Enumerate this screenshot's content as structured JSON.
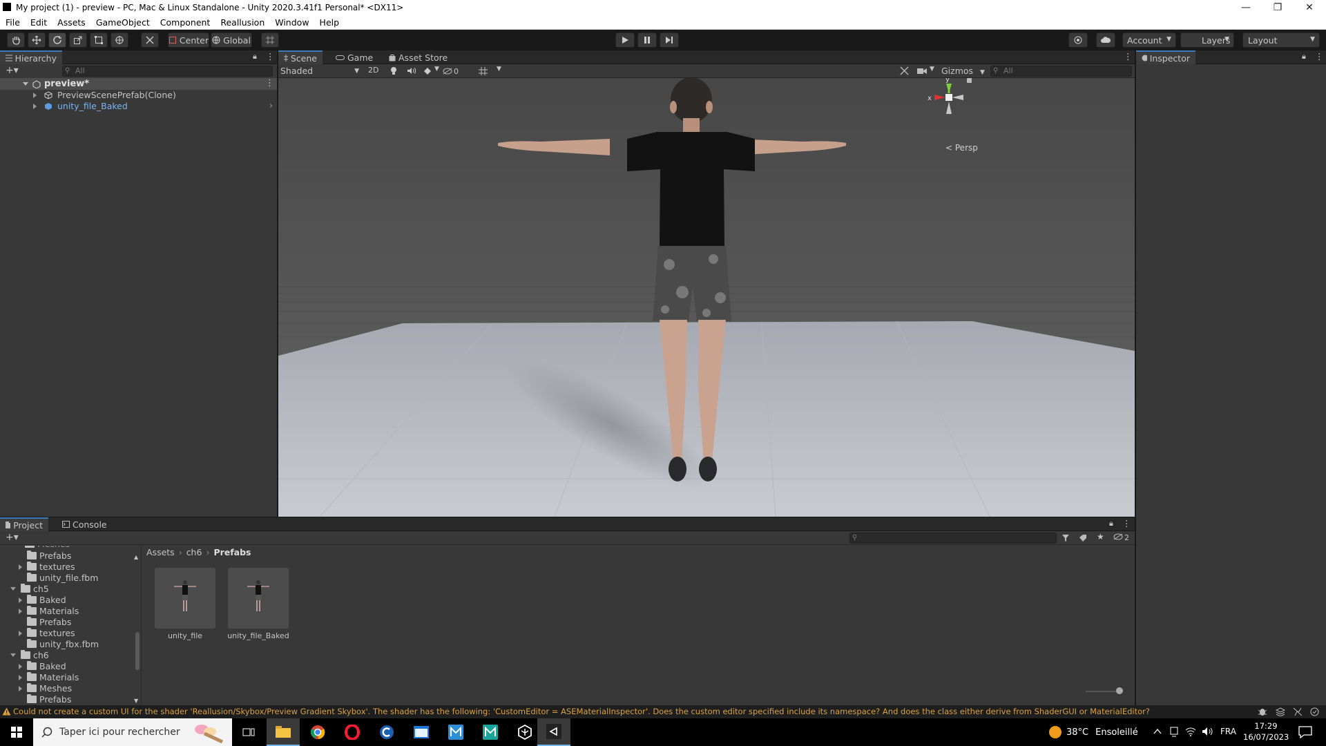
{
  "window": {
    "title": "My project (1) - preview - PC, Mac & Linux Standalone - Unity 2020.3.41f1 Personal* <DX11>",
    "minimize": "—",
    "maximize": "❐",
    "close": "✕"
  },
  "menu": [
    "File",
    "Edit",
    "Assets",
    "GameObject",
    "Component",
    "Reallusion",
    "Window",
    "Help"
  ],
  "toolbar": {
    "pivot": "Center",
    "space": "Global",
    "account": "Account",
    "layers": "Layers",
    "layout": "Layout"
  },
  "hierarchy": {
    "tab": "Hierarchy",
    "search_placeholder": "All",
    "scene": "preview*",
    "items": [
      "PreviewScenePrefab(Clone)",
      "unity_file_Baked"
    ]
  },
  "scene_view": {
    "tabs": [
      "Scene",
      "Game",
      "Asset Store"
    ],
    "shading": "Shaded",
    "mode_2d": "2D",
    "hidden_count": "0",
    "gizmos": "Gizmos",
    "search_placeholder": "All",
    "persp_label": "Persp",
    "axis_x": "x",
    "axis_y": "y"
  },
  "inspector": {
    "tab": "Inspector"
  },
  "project": {
    "tabs": [
      "Project",
      "Console"
    ],
    "hidden_count": "2",
    "tree": [
      {
        "label": "Prefabs",
        "indent": 2,
        "arrow": "none"
      },
      {
        "label": "textures",
        "indent": 2,
        "arrow": "right"
      },
      {
        "label": "unity_file.fbm",
        "indent": 2,
        "arrow": "none"
      },
      {
        "label": "ch5",
        "indent": 1,
        "arrow": "down"
      },
      {
        "label": "Baked",
        "indent": 2,
        "arrow": "right"
      },
      {
        "label": "Materials",
        "indent": 2,
        "arrow": "right"
      },
      {
        "label": "Prefabs",
        "indent": 2,
        "arrow": "none"
      },
      {
        "label": "textures",
        "indent": 2,
        "arrow": "right"
      },
      {
        "label": "unity_fbx.fbm",
        "indent": 2,
        "arrow": "none"
      },
      {
        "label": "ch6",
        "indent": 1,
        "arrow": "down"
      },
      {
        "label": "Baked",
        "indent": 2,
        "arrow": "right"
      },
      {
        "label": "Materials",
        "indent": 2,
        "arrow": "right"
      },
      {
        "label": "Meshes",
        "indent": 2,
        "arrow": "right"
      },
      {
        "label": "Prefabs",
        "indent": 2,
        "arrow": "none"
      }
    ],
    "breadcrumb": [
      "Assets",
      "ch6",
      "Prefabs"
    ],
    "assets": [
      "unity_file",
      "unity_file_Baked"
    ]
  },
  "status": {
    "message": "Could not create a custom UI for the shader 'Reallusion/Skybox/Preview Gradient Skybox'. The shader has the following: 'CustomEditor = ASEMaterialInspector'. Does the custom editor specified include its namespace? And does the class either derive from ShaderGUI or MaterialEditor?"
  },
  "taskbar": {
    "search_placeholder": "Taper ici pour rechercher",
    "weather_temp": "38°C",
    "weather_desc": "Ensoleillé",
    "language": "FRA",
    "time": "17:29",
    "date": "16/07/2023"
  },
  "colors": {
    "accent": "#3a79bb",
    "panel": "#383838",
    "warning": "#d9a13e"
  }
}
